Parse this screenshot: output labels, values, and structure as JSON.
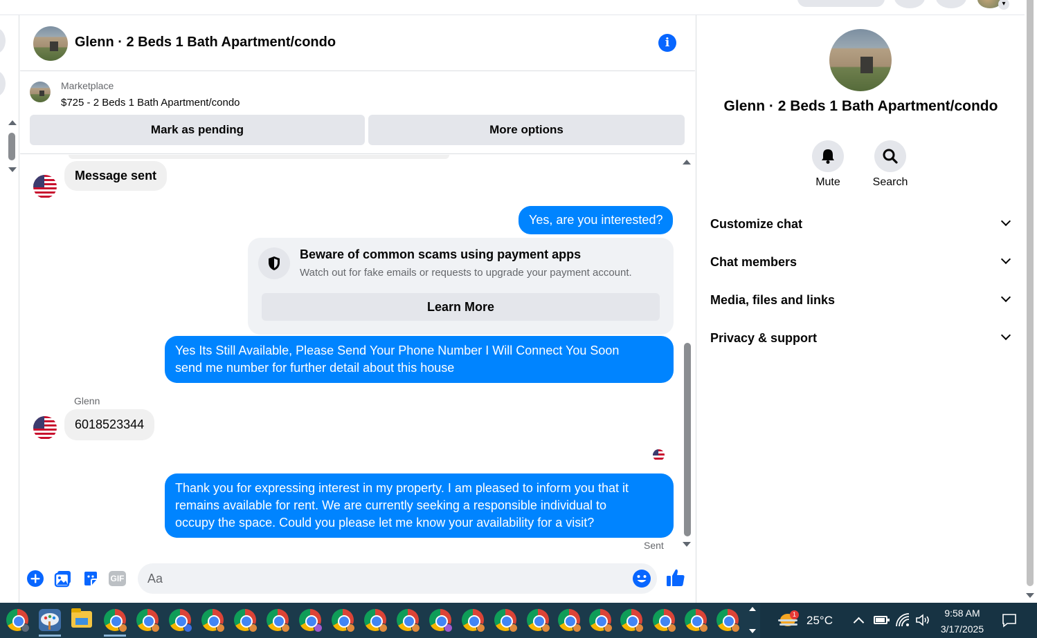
{
  "header": {
    "title": "Glenn · 2 Beds 1 Bath Apartment/condo",
    "info_icon": "i"
  },
  "listing": {
    "label": "Marketplace",
    "price_title": "$725 - 2 Beds 1 Bath Apartment/condo",
    "mark_pending": "Mark as pending",
    "more_options": "More options"
  },
  "messages": {
    "msg1": "Message sent",
    "msg2": "Yes, are you interested?",
    "scam_title": "Beware of common scams using payment apps",
    "scam_sub": "Watch out for fake emails or requests to upgrade your payment account.",
    "learn_more": "Learn More",
    "msg3_line1": "Yes Its Still Available, Please Send Your Phone Number I Will Connect You Soon",
    "msg3_line2": "send me number for further detail about this house",
    "sender": "Glenn",
    "msg4": "6018523344",
    "msg5_line1": "Thank you for expressing interest in my property. I am pleased to inform you that it",
    "msg5_line2": "remains available for rent. We are currently seeking a responsible individual to",
    "msg5_line3": "occupy the space. Could you please let me know your availability for a visit?",
    "status": "Sent"
  },
  "composer": {
    "placeholder": "Aa",
    "gif_label": "GIF"
  },
  "panel": {
    "title": "Glenn · 2 Beds 1 Bath Apartment/condo",
    "mute": "Mute",
    "search": "Search",
    "sections": [
      "Customize chat",
      "Chat members",
      "Media, files and links",
      "Privacy & support"
    ]
  },
  "taskbar": {
    "weather_temp": "25°C",
    "weather_badge": "1",
    "time": "9:58 AM",
    "date": "3/17/2025"
  },
  "colors": {
    "accent": "#0866ff",
    "outgoing_bubble": "#0084ff",
    "incoming_bubble": "#f0f0f0",
    "taskbar": "#1b3a4b"
  }
}
